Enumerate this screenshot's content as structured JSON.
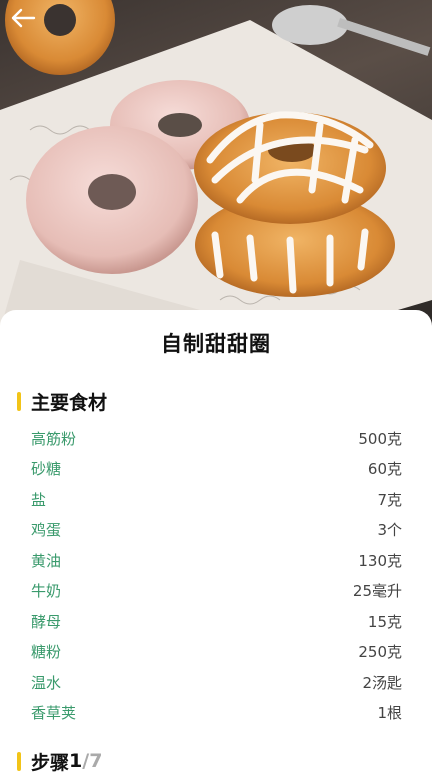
{
  "header": {
    "back_icon": "arrow-left-icon"
  },
  "recipe": {
    "title": "自制甜甜圈"
  },
  "ingredients": {
    "heading": "主要食材",
    "items": [
      {
        "name": "高筋粉",
        "qty": "500克"
      },
      {
        "name": "砂糖",
        "qty": "60克"
      },
      {
        "name": "盐",
        "qty": "7克"
      },
      {
        "name": "鸡蛋",
        "qty": "3个"
      },
      {
        "name": "黄油",
        "qty": "130克"
      },
      {
        "name": "牛奶",
        "qty": "25毫升"
      },
      {
        "name": "酵母",
        "qty": "15克"
      },
      {
        "name": "糖粉",
        "qty": "250克"
      },
      {
        "name": "温水",
        "qty": "2汤匙"
      },
      {
        "name": "香草荚",
        "qty": "1根"
      }
    ]
  },
  "steps": {
    "heading": "步骤",
    "current": "1",
    "total": "/7"
  },
  "colors": {
    "accent_bar": "#f2c418",
    "ingredient_name": "#3a9a6c"
  }
}
